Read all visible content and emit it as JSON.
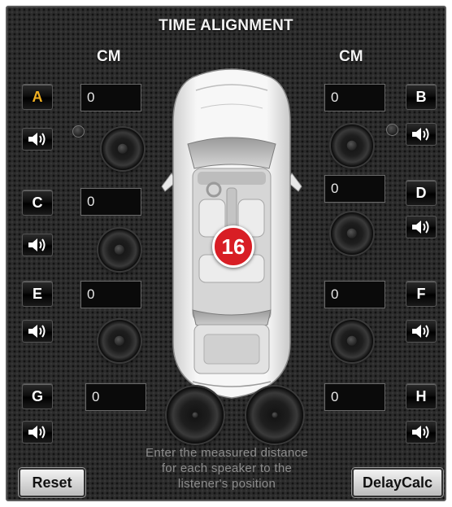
{
  "panel": {
    "title": "TIME ALIGNMENT",
    "unit_left": "CM",
    "unit_right": "CM",
    "badge": "16"
  },
  "channels": {
    "A": {
      "label": "A",
      "value": "0",
      "active": true
    },
    "B": {
      "label": "B",
      "value": "0"
    },
    "C": {
      "label": "C",
      "value": "0"
    },
    "D": {
      "label": "D",
      "value": "0"
    },
    "E": {
      "label": "E",
      "value": "0"
    },
    "F": {
      "label": "F",
      "value": "0"
    },
    "G": {
      "label": "G",
      "value": "0"
    },
    "H": {
      "label": "H",
      "value": "0"
    }
  },
  "hint": {
    "line1": "Enter the measured distance",
    "line2": "for each speaker to the",
    "line3": "listener's position"
  },
  "buttons": {
    "reset": "Reset",
    "delaycalc": "DelayCalc"
  },
  "colors": {
    "active_channel": "#f1b022",
    "badge": "#d81e25"
  },
  "icons": {
    "speaker_toggle": "speaker-volume-icon"
  }
}
